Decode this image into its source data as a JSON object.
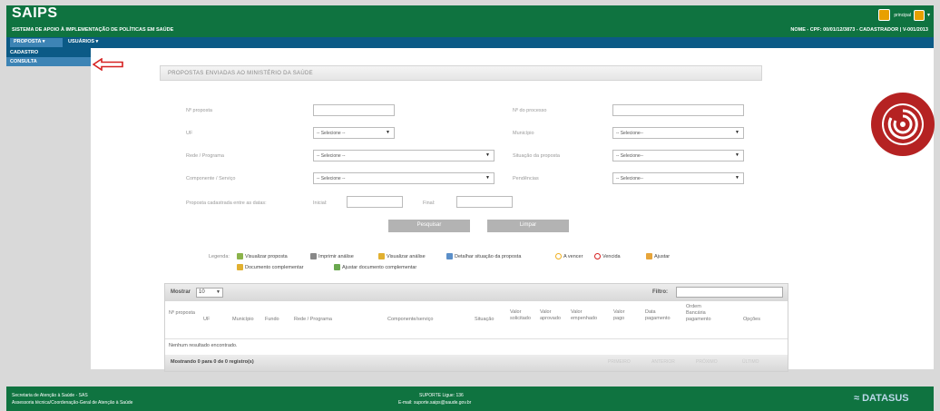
{
  "header": {
    "logo": "SAIPS",
    "subtitle": "SISTEMA DE APOIO À IMPLEMENTAÇÃO DE POLÍTICAS EM SAÚDE",
    "user_info": "NOME - CPF: 00/01/12/3873 - CADASTRADOR | V-001/2013",
    "home_label": "principal"
  },
  "menu": {
    "proposta": "PROPOSTA ▾",
    "usuarios": "USUÁRIOS ▾",
    "dropdown": [
      "CADASTRO",
      "CONSULTA"
    ]
  },
  "panel": {
    "title": "PROPOSTAS ENVIADAS AO MINISTÉRIO DA SAÚDE"
  },
  "filters": {
    "numero_proposta": "Nº proposta",
    "numero_processo": "Nº do processo",
    "uf": "UF",
    "municipio": "Município",
    "rede_programa": "Rede / Programa",
    "situacao_proposta": "Situação da proposta",
    "componente_servico": "Componente / Serviço",
    "pendencias": "Pendências",
    "data_range": "Proposta cadastrada entre as datas:",
    "inicial": "Inicial:",
    "final": "Final:",
    "select_default": "-- Selecione --",
    "select_default2": "-- Selecione--"
  },
  "buttons": {
    "pesquisar": "Pesquisar",
    "limpar": "Limpar"
  },
  "legend": {
    "label": "Legenda:",
    "items": [
      "Visualizar proposta",
      "Imprimir análise",
      "Visualizar análise",
      "Detalhar situação da proposta",
      "A vencer",
      "Vencida",
      "Ajustar",
      "Documento complementar",
      "Ajustar documento complementar"
    ]
  },
  "table": {
    "mostrar": "Mostrar",
    "page_size": "10",
    "filtro": "Filtro:",
    "headers": [
      "Nº proposta",
      "UF",
      "Município",
      "Fundo",
      "Rede / Programa",
      "Componente/serviço",
      "Situação",
      "Valor solicitado",
      "Valor aprovado",
      "Valor empenhado",
      "Valor pago",
      "Data pagamento",
      "Ordem Bancária pagamento",
      "Opções"
    ],
    "empty": "Nenhum resultado encontrado.",
    "status": "Mostrando 0 para 0 de 0 registro(s)",
    "pager": [
      "PRIMEIRO",
      "ANTERIOR",
      "PRÓXIMO",
      "ÚLTIMO"
    ]
  },
  "footer": {
    "left1": "Secretaria de Atenção à Saúde - SAS",
    "left2": "Assessoria técnica/Coordenação-Geral de Atenção à Saúde",
    "center1": "SUPORTE Ligue: 136",
    "center2": "E-mail: suporte.saips@saude.gov.br",
    "brand": "DATASUS"
  },
  "colors": {
    "green": "#0f7340",
    "blue": "#0b5a86",
    "highlight": "#3d84b5",
    "arrow": "#d62020"
  }
}
